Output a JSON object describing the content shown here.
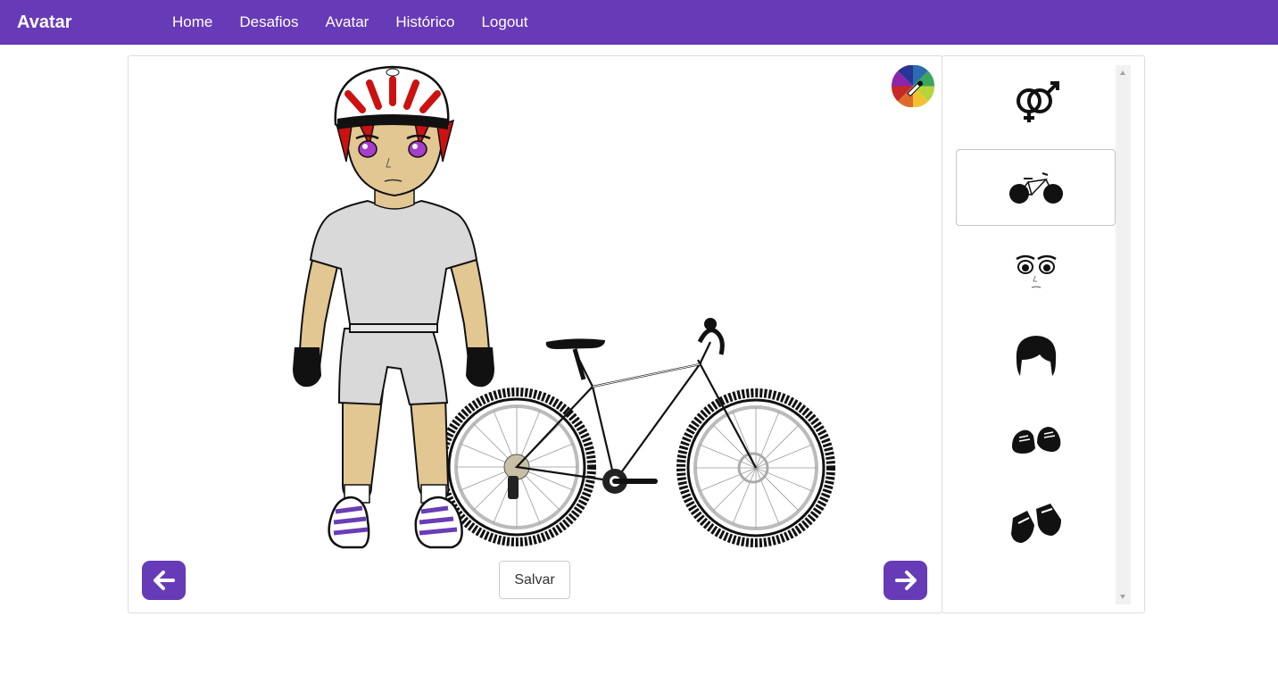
{
  "navbar": {
    "brand": "Avatar",
    "links": [
      "Home",
      "Desafios",
      "Avatar",
      "Histórico",
      "Logout"
    ],
    "background_color": "#673ab7"
  },
  "stage": {
    "save_label": "Salvar",
    "prev_icon": "arrow-left-icon",
    "next_icon": "arrow-right-icon",
    "color_picker_icon": "color-wheel-icon"
  },
  "sidebar": {
    "categories": [
      {
        "icon": "gender-icon",
        "active": false
      },
      {
        "icon": "bicycle-icon",
        "active": true
      },
      {
        "icon": "face-icon",
        "active": false
      },
      {
        "icon": "hair-icon",
        "active": false
      },
      {
        "icon": "shoes-icon",
        "active": false
      },
      {
        "icon": "gloves-icon",
        "active": false
      }
    ]
  },
  "colors": {
    "accent": "#673ab7",
    "skin": "#e2c792",
    "shirt": "#d9d9d9",
    "helmet_red": "#cc1111",
    "eyes": "#a63ec9"
  }
}
